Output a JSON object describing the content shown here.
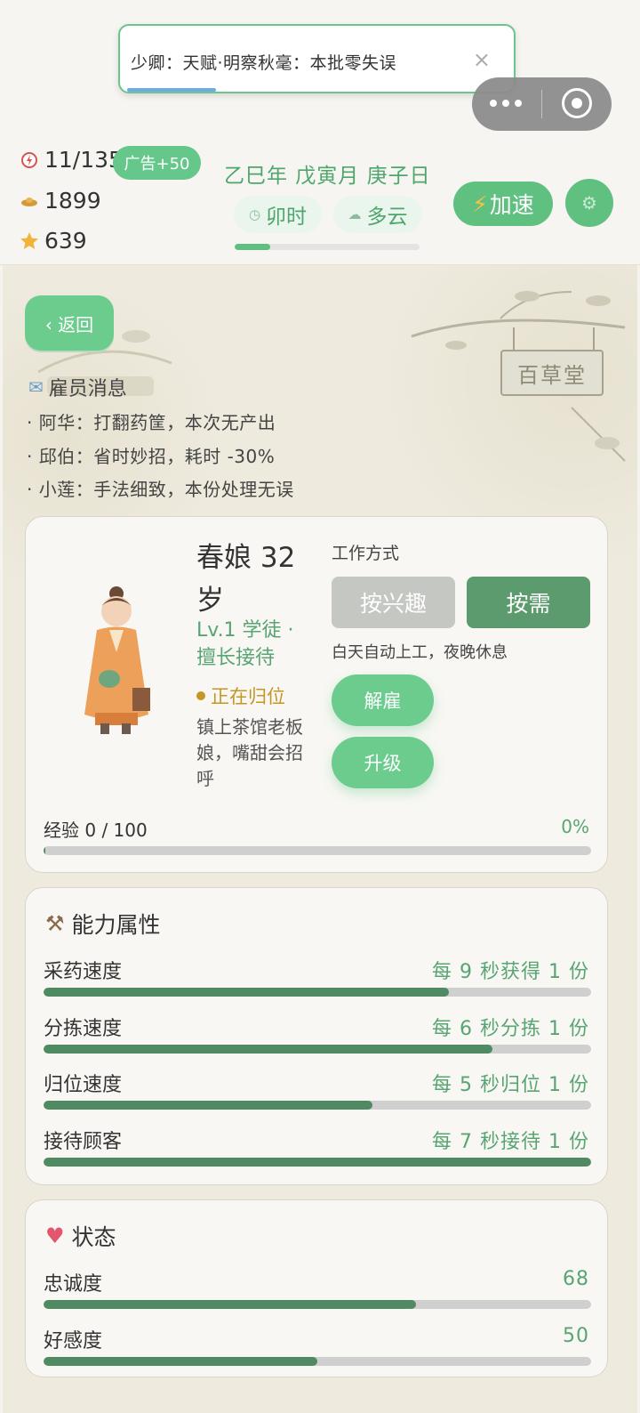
{
  "toast": {
    "text": "少卿：天赋·明察秋毫：本批零失误",
    "close": "×"
  },
  "resources": {
    "energy": "11/135",
    "ad_badge": "广告+50",
    "coins": "1899",
    "stars": "639"
  },
  "calendar": {
    "date": "乙巳年 戊寅月 庚子日",
    "time": "卯时",
    "weather": "多云",
    "time_progress": 0.19
  },
  "header_buttons": {
    "speed": "加速"
  },
  "scene": {
    "sign": "百草堂",
    "back": "‹ 返回"
  },
  "messages": {
    "title": "雇员消息",
    "lines": [
      "· 阿华：打翻药筐，本次无产出",
      "· 邱伯：省时妙招，耗时 -30%",
      "· 小莲：手法细致，本份处理无误"
    ]
  },
  "employee": {
    "name": "春娘  32 岁",
    "level": "Lv.1 学徒 · 擅长接待",
    "state": "正在归位",
    "description": "镇上茶馆老板娘，嘴甜会招呼",
    "work_label": "工作方式",
    "mode_interest": "按兴趣",
    "mode_need": "按需",
    "work_desc": "白天自动上工，夜晚休息",
    "fire": "解雇",
    "upgrade": "升级",
    "exp_label": "经验 0 / 100",
    "exp_pct": "0%",
    "exp_fraction": 0.0
  },
  "abilities": {
    "title": "能力属性",
    "rows": [
      {
        "label": "采药速度",
        "value": "每 9 秒获得 1 份",
        "level": 0.74
      },
      {
        "label": "分拣速度",
        "value": "每 6 秒分拣 1 份",
        "level": 0.82
      },
      {
        "label": "归位速度",
        "value": "每 5 秒归位 1 份",
        "level": 0.6
      },
      {
        "label": "接待顾客",
        "value": "每 7 秒接待 1 份",
        "level": 1.0
      }
    ]
  },
  "status": {
    "title": "状态",
    "rows": [
      {
        "label": "忠诚度",
        "value": "68",
        "level": 0.68
      },
      {
        "label": "好感度",
        "value": "50",
        "level": 0.5
      }
    ]
  }
}
